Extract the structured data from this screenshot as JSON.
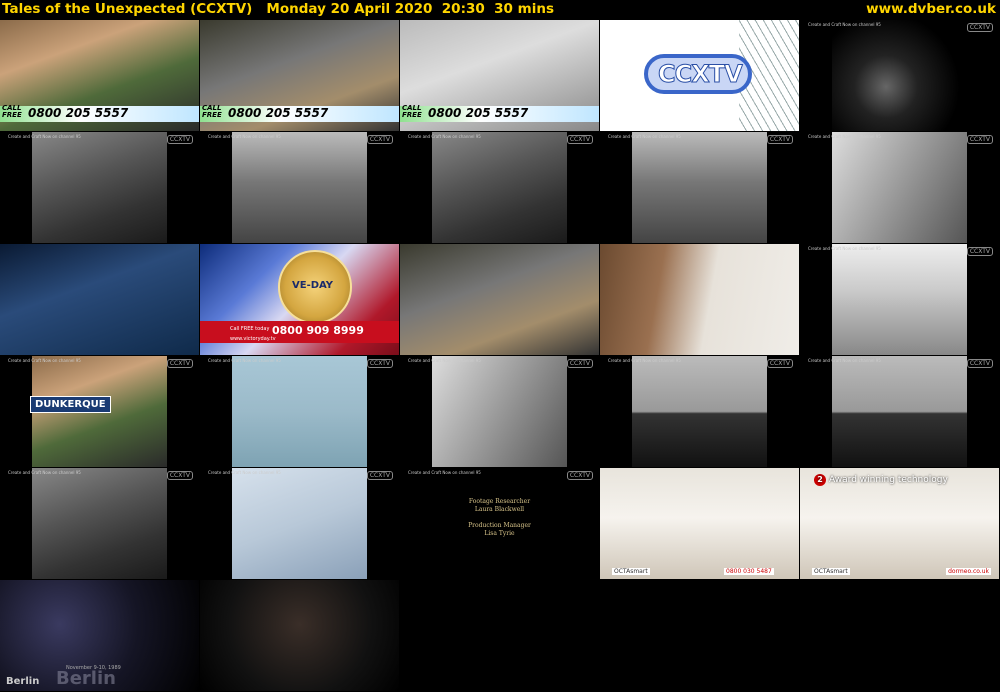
{
  "header": {
    "title": "Tales of the Unexpected (CCXTV)   Monday 20 April 2020  20:30  30 mins",
    "site": "www.dvber.co.uk"
  },
  "overlays": {
    "call_free": "CALL FREE",
    "phone_1": "0800 205 5557",
    "channel_logo": "CCXTV",
    "channel_note": "Create and Craft Now on channel 95",
    "watermark": "CCXTV",
    "ve_phone": "0800 909 8999",
    "ve_call": "Call FREE today",
    "ve_url": "www.victoryday.tv",
    "ve_coin": "VE-DAY",
    "sign_text": "DUNKERQUE",
    "credits": [
      "Footage Researcher",
      "Laura Blackwell",
      "Production Manager",
      "Lisa Tyrie"
    ],
    "octa": "OCTAsmart",
    "octa_phone": "0800 030 5487",
    "award": "Award winning technology",
    "award_num": "2",
    "dormeo": "dormeo.co.uk",
    "berlin": "Berlin",
    "berlin_big": "Berlin",
    "berlin_date": "November 9-10, 1989"
  }
}
